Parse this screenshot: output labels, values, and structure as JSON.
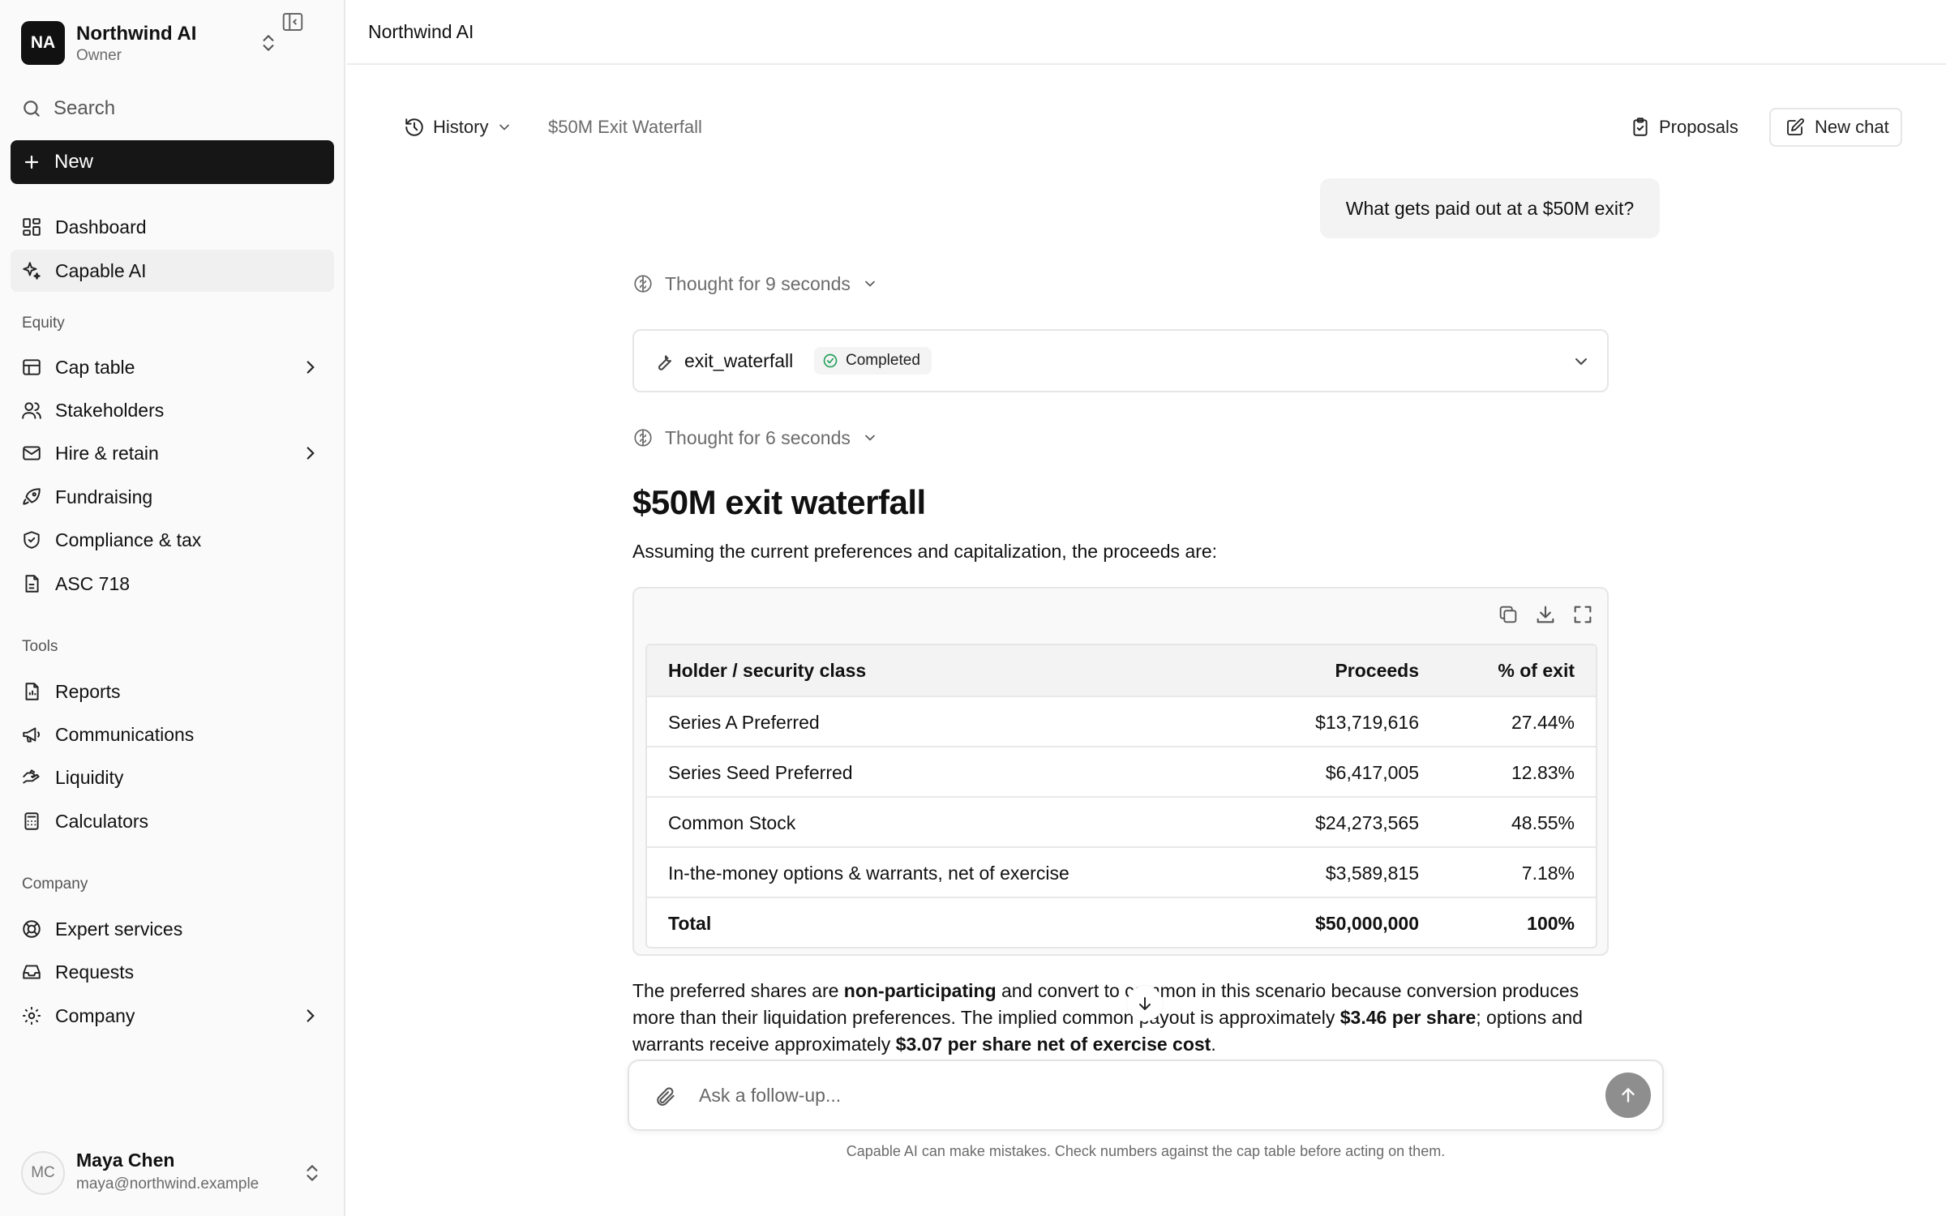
{
  "org": {
    "initials": "NA",
    "name": "Northwind AI",
    "role": "Owner"
  },
  "sidebar": {
    "search_label": "Search",
    "new_label": "New",
    "top_items": [
      {
        "label": "Dashboard",
        "icon": "dashboard-icon"
      },
      {
        "label": "Capable AI",
        "icon": "sparkles-icon",
        "active": true
      }
    ],
    "sections": [
      {
        "label": "Equity",
        "items": [
          {
            "label": "Cap table",
            "icon": "table-icon",
            "has_submenu": true
          },
          {
            "label": "Stakeholders",
            "icon": "users-icon"
          },
          {
            "label": "Hire & retain",
            "icon": "mail-icon",
            "has_submenu": true
          },
          {
            "label": "Fundraising",
            "icon": "rocket-icon"
          },
          {
            "label": "Compliance & tax",
            "icon": "shield-icon"
          },
          {
            "label": "ASC 718",
            "icon": "document-icon"
          }
        ]
      },
      {
        "label": "Tools",
        "items": [
          {
            "label": "Reports",
            "icon": "report-icon"
          },
          {
            "label": "Communications",
            "icon": "megaphone-icon"
          },
          {
            "label": "Liquidity",
            "icon": "liquidity-icon"
          },
          {
            "label": "Calculators",
            "icon": "calculator-icon"
          }
        ]
      },
      {
        "label": "Company",
        "items": [
          {
            "label": "Expert services",
            "icon": "lifebuoy-icon"
          },
          {
            "label": "Requests",
            "icon": "inbox-icon"
          },
          {
            "label": "Company",
            "icon": "gear-icon",
            "has_submenu": true
          }
        ]
      }
    ]
  },
  "user": {
    "initials": "MC",
    "name": "Maya Chen",
    "email": "maya@northwind.example"
  },
  "topbar": {
    "title": "Northwind AI"
  },
  "chat": {
    "history_label": "History",
    "title": "$50M Exit Waterfall",
    "proposals_label": "Proposals",
    "new_chat_label": "New chat",
    "user_message": "What gets paid out at a $50M exit?",
    "thought_1": "Thought for 9 seconds",
    "thought_2": "Thought for 6 seconds",
    "tool": {
      "name": "exit_waterfall",
      "status": "Completed"
    },
    "answer_heading": "$50M exit waterfall",
    "answer_intro": "Assuming the current preferences and capitalization, the proceeds are:",
    "table": {
      "headers": [
        "Holder / security class",
        "Proceeds",
        "% of exit"
      ],
      "rows": [
        [
          "Series A Preferred",
          "$13,719,616",
          "27.44%"
        ],
        [
          "Series Seed Preferred",
          "$6,417,005",
          "12.83%"
        ],
        [
          "Common Stock",
          "$24,273,565",
          "48.55%"
        ],
        [
          "In-the-money options & warrants, net of exercise",
          "$3,589,815",
          "7.18%"
        ]
      ],
      "total": [
        "Total",
        "$50,000,000",
        "100%"
      ]
    },
    "answer_paragraph": {
      "t1": "The preferred shares are ",
      "b1": "non-participating",
      "t2": " and convert to common in this scenario because conversion produces more than their liquidation preferences. The implied common payout is approximately ",
      "b2": "$3.46 per share",
      "t3": "; options and warrants receive approximately ",
      "b3": "$3.07 per share net of exercise cost",
      "t4": "."
    },
    "composer_placeholder": "Ask a follow-up...",
    "disclaimer": "Capable AI can make mistakes. Check numbers against the cap table before acting on them."
  }
}
